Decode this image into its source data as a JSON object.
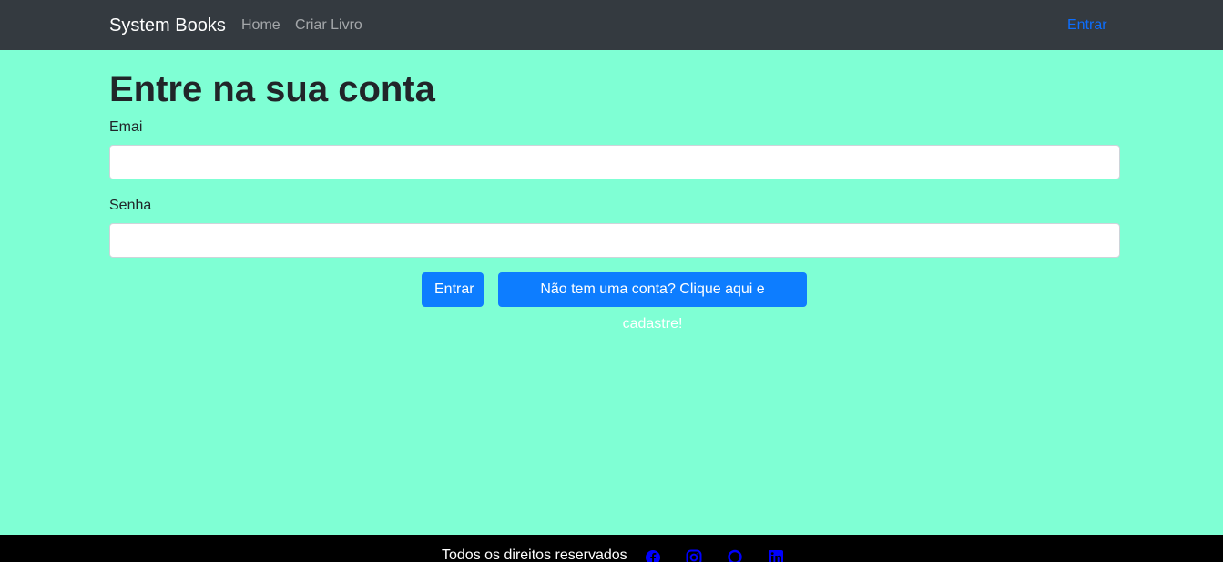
{
  "navbar": {
    "brand": "System Books",
    "links": [
      "Home",
      "Criar Livro"
    ],
    "login": "Entrar"
  },
  "main": {
    "title": "Entre na sua conta",
    "email_label": "Emai",
    "email_value": "",
    "password_label": "Senha",
    "password_value": "",
    "login_button": "Entrar",
    "signup_button": "Não tem uma conta? Clique aqui e cadastre!"
  },
  "footer": {
    "text": "Todos os direitos reservados",
    "social_icons": [
      "facebook-icon",
      "instagram-icon",
      "github-icon",
      "linkedin-icon"
    ]
  },
  "colors": {
    "background": "#7fffd4",
    "navbar": "#343a40",
    "primary_button": "#0d7dff",
    "link_active": "#0d6efd",
    "footer": "#000000",
    "social_icon": "#0000ff"
  }
}
